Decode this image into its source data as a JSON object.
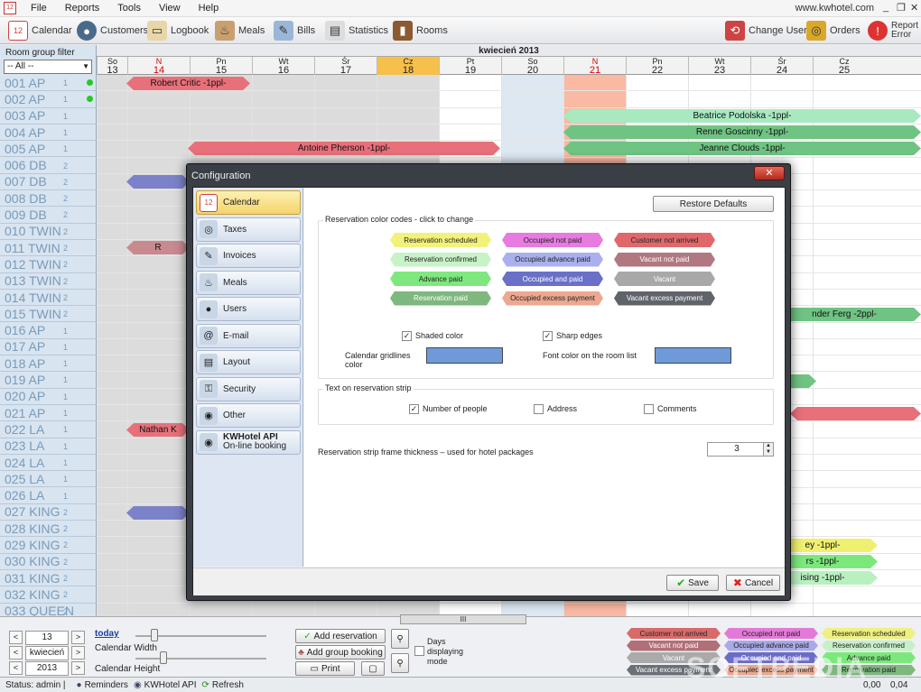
{
  "menu": {
    "app_icon": "calendar-app-icon",
    "items": [
      "File",
      "Reports",
      "Tools",
      "View",
      "Help"
    ],
    "site": "www.kwhotel.com",
    "min": "_",
    "restore": "❐",
    "close": "✕"
  },
  "toolbar": {
    "calendar": "Calendar",
    "customers": "Customers",
    "logbook": "Logbook",
    "meals": "Meals",
    "bills": "Bills",
    "statistics": "Statistics",
    "rooms": "Rooms",
    "change_user": "Change User",
    "orders": "Orders",
    "report_error": "Report Error"
  },
  "calendar": {
    "room_filter_label": "Room group filter",
    "room_filter_value": "-- All --",
    "month": "kwiecień 2013",
    "days": [
      {
        "d": "So",
        "n": "13"
      },
      {
        "d": "N",
        "n": "14",
        "red": true
      },
      {
        "d": "Pn",
        "n": "15"
      },
      {
        "d": "Wt",
        "n": "16"
      },
      {
        "d": "Śr",
        "n": "17"
      },
      {
        "d": "Cz",
        "n": "18",
        "today": true
      },
      {
        "d": "Pt",
        "n": "19"
      },
      {
        "d": "So",
        "n": "20"
      },
      {
        "d": "N",
        "n": "21",
        "red": true
      },
      {
        "d": "Pn",
        "n": "22"
      },
      {
        "d": "Wt",
        "n": "23"
      },
      {
        "d": "Śr",
        "n": "24"
      },
      {
        "d": "Cz",
        "n": "25"
      }
    ],
    "rooms": [
      {
        "name": "001 AP",
        "cap": "1",
        "dot": true
      },
      {
        "name": "002 AP",
        "cap": "1",
        "dot": true
      },
      {
        "name": "003 AP",
        "cap": "1"
      },
      {
        "name": "004 AP",
        "cap": "1"
      },
      {
        "name": "005 AP",
        "cap": "1"
      },
      {
        "name": "006 DB",
        "cap": "2"
      },
      {
        "name": "007 DB",
        "cap": "2"
      },
      {
        "name": "008 DB",
        "cap": "2"
      },
      {
        "name": "009 DB",
        "cap": "2"
      },
      {
        "name": "010 TWIN",
        "cap": "2"
      },
      {
        "name": "011 TWIN",
        "cap": "2"
      },
      {
        "name": "012 TWIN",
        "cap": "2"
      },
      {
        "name": "013 TWIN",
        "cap": "2"
      },
      {
        "name": "014 TWIN",
        "cap": "2"
      },
      {
        "name": "015 TWIN",
        "cap": "2"
      },
      {
        "name": "016 AP",
        "cap": "1"
      },
      {
        "name": "017 AP",
        "cap": "1"
      },
      {
        "name": "018 AP",
        "cap": "1"
      },
      {
        "name": "019 AP",
        "cap": "1"
      },
      {
        "name": "020 AP",
        "cap": "1"
      },
      {
        "name": "021 AP",
        "cap": "1"
      },
      {
        "name": "022 LA",
        "cap": "1"
      },
      {
        "name": "023 LA",
        "cap": "1"
      },
      {
        "name": "024 LA",
        "cap": "1"
      },
      {
        "name": "025 LA",
        "cap": "1"
      },
      {
        "name": "026 LA",
        "cap": "1"
      },
      {
        "name": "027 KING",
        "cap": "2"
      },
      {
        "name": "028 KING",
        "cap": "2"
      },
      {
        "name": "029 KING",
        "cap": "2"
      },
      {
        "name": "030 KING",
        "cap": "2"
      },
      {
        "name": "031 KING",
        "cap": "2"
      },
      {
        "name": "032 KING",
        "cap": "2"
      },
      {
        "name": "033 QUEEN",
        "cap": "2"
      }
    ],
    "reservations": [
      {
        "label": "Robert Critic -1ppl-",
        "color": "#e8707a"
      },
      {
        "label": "Antoine Pherson -1ppl-",
        "color": "#e8707a"
      },
      {
        "label": "Beatrice Podolska -1ppl-",
        "color": "#a9e9c0"
      },
      {
        "label": "Renne Goscinny -1ppl-",
        "color": "#6fc383"
      },
      {
        "label": "Jeanne Clouds -1ppl-",
        "color": "#6fc383"
      },
      {
        "label": "",
        "color": "#7b82c9"
      },
      {
        "label": "R",
        "color": "#c88a8f"
      },
      {
        "label": "nder Ferg -2ppl-",
        "color": "#6fc383"
      },
      {
        "label": "",
        "color": "#6fc383"
      },
      {
        "label": "",
        "color": "#e8707a"
      },
      {
        "label": "Nathan K",
        "color": "#e8707a"
      },
      {
        "label": "",
        "color": "#7b82c9"
      },
      {
        "label": "ey -1ppl-",
        "color": "#f0f070"
      },
      {
        "label": "rs -1ppl-",
        "color": "#7ce87c"
      },
      {
        "label": "ising -1ppl-",
        "color": "#b9f0c0"
      }
    ]
  },
  "bottom": {
    "day": "13",
    "month": "kwiecień",
    "year": "2013",
    "today": "today",
    "cal_width": "Calendar Width",
    "cal_height": "Calendar Height",
    "add_res": "Add reservation",
    "add_group": "Add group booking",
    "print": "Print",
    "days_mode": "Days displaying mode",
    "scroll": "III",
    "legend": [
      {
        "label": "Customer not arrived",
        "color": "#d96a6a"
      },
      {
        "label": "Occupied not paid",
        "color": "#e47ad8"
      },
      {
        "label": "Reservation scheduled",
        "color": "#eef080"
      },
      {
        "label": "Vacant not paid",
        "color": "#b07078"
      },
      {
        "label": "Occupied advance paid",
        "color": "#a9a9e8"
      },
      {
        "label": "Reservation confirmed",
        "color": "#c8f0c8"
      },
      {
        "label": "Vacant",
        "color": "#aaaaaa"
      },
      {
        "label": "Occupied and paid",
        "color": "#6b6bc8"
      },
      {
        "label": "Advance paid",
        "color": "#7ce87c"
      },
      {
        "label": "Vacant excess payment",
        "color": "#6b6f76"
      },
      {
        "label": "Occupied excess payment",
        "color": "#e8a890"
      },
      {
        "label": "Reservation paid",
        "color": "#7fb87f"
      }
    ]
  },
  "status": {
    "user": "Status: admin |",
    "reminders": "Reminders",
    "api": "KWHotel API",
    "refresh": "Refresh",
    "val1": "0,00",
    "val2": "0,04",
    "watermark": "SOFTPEDIA"
  },
  "dialog": {
    "title": "Configuration",
    "close": "✕",
    "nav": [
      {
        "label": "Calendar",
        "icon": "calendar-icon",
        "selected": true
      },
      {
        "label": "Taxes",
        "icon": "coins-icon"
      },
      {
        "label": "Invoices",
        "icon": "invoice-icon"
      },
      {
        "label": "Meals",
        "icon": "meals-icon"
      },
      {
        "label": "Users",
        "icon": "users-icon"
      },
      {
        "label": "E-mail",
        "icon": "email-icon"
      },
      {
        "label": "Layout",
        "icon": "layout-icon"
      },
      {
        "label": "Security",
        "icon": "security-icon"
      },
      {
        "label": "Other",
        "icon": "other-icon"
      },
      {
        "label": "KWHotel API",
        "sub": "On-line booking",
        "icon": "api-icon"
      }
    ],
    "restore": "Restore Defaults",
    "color_group": "Reservation color codes - click to change",
    "colors": [
      {
        "label": "Reservation scheduled",
        "color": "#f2f27a"
      },
      {
        "label": "Occupied not paid",
        "color": "#e77be0"
      },
      {
        "label": "Customer not arrived",
        "color": "#e0686a"
      },
      {
        "label": "Reservation confirmed",
        "color": "#c8f2c8"
      },
      {
        "label": "Occupied advance paid",
        "color": "#aab0ee"
      },
      {
        "label": "Vacant not paid",
        "color": "#b07880"
      },
      {
        "label": "Advance paid",
        "color": "#7ee87e"
      },
      {
        "label": "Occupied and paid",
        "color": "#6a70c8"
      },
      {
        "label": "Vacant",
        "color": "#a8a8a8"
      },
      {
        "label": "Reservation paid",
        "color": "#7fb87f"
      },
      {
        "label": "Occupied excess payment",
        "color": "#eca890"
      },
      {
        "label": "Vacant excess payment",
        "color": "#60646a"
      }
    ],
    "shaded": "Shaded color",
    "sharp": "Sharp edges",
    "gridlines": "Calendar gridlines color",
    "fontcolor": "Font color on the room list",
    "swatch_color": "#6e9bd8",
    "text_group": "Text on reservation strip",
    "people": "Number of people",
    "address": "Address",
    "comments": "Comments",
    "frame_label": "Reservation strip frame thickness – used for hotel packages",
    "frame_value": "3",
    "save": "Save",
    "cancel": "Cancel"
  }
}
